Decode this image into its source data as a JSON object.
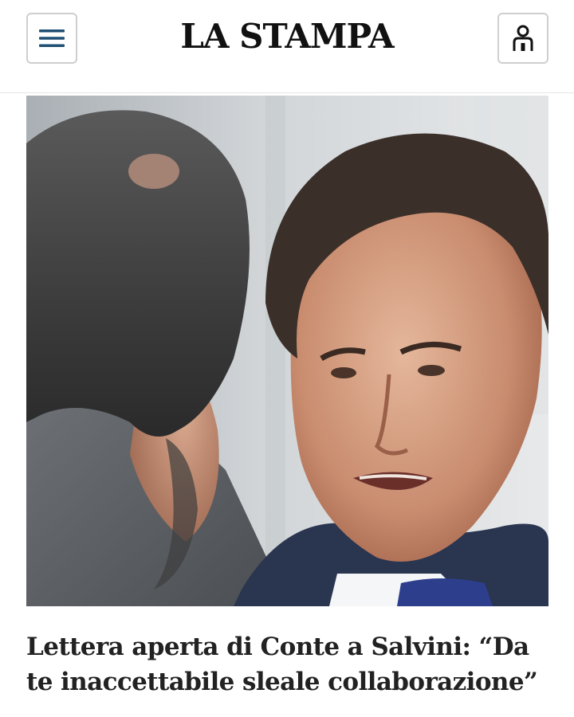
{
  "header": {
    "logo_text": "LA STAMPA",
    "menu_icon": "hamburger-menu-icon",
    "user_icon": "user-account-icon",
    "accent_color": "#1f4f73"
  },
  "article": {
    "image_alt": "Photo of two men talking face to face",
    "headline": "Lettera aperta di Conte a Salvini: “Da te inaccettabile sleale collaborazione”"
  }
}
